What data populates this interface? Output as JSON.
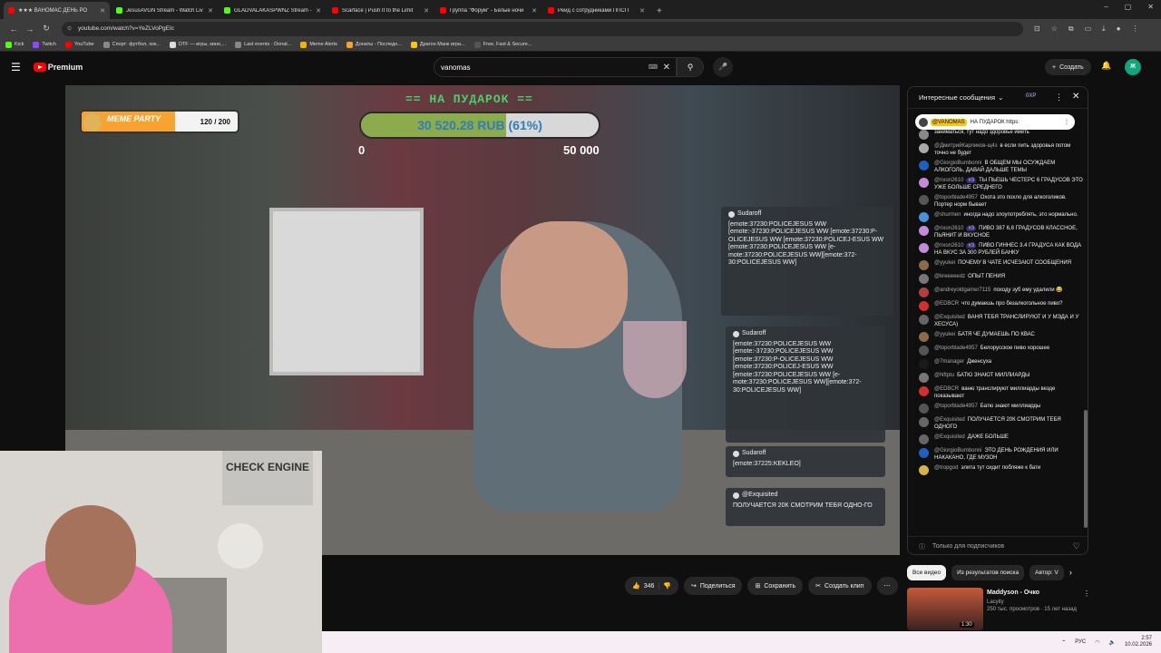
{
  "browser": {
    "tabs": [
      {
        "title": "★★★ ВАНОМАС ДЕНЬ РО",
        "color": "#ff0000",
        "active": true
      },
      {
        "title": "JesusAVGN Stream - Watch Liv",
        "color": "#53fc18",
        "active": false
      },
      {
        "title": "GLADVALAKASPWNZ Stream -",
        "color": "#53fc18",
        "active": false
      },
      {
        "title": "Scarface | Push It to the Limit",
        "color": "#ff0000",
        "active": false
      },
      {
        "title": "Группа \"Форум\" - Белые ночи",
        "color": "#ff0000",
        "active": false
      },
      {
        "title": "Рейд с сотрудниками ППСП",
        "color": "#ff0000",
        "active": false
      }
    ],
    "new_tab": "+",
    "window_controls": [
      "‒",
      "▢",
      "✕"
    ],
    "url": "youtube.com/watch?v=YeZLVoPgEIc",
    "bookmarks": [
      {
        "label": "Kick",
        "color": "#53fc18"
      },
      {
        "label": "Twitch",
        "color": "#9146ff"
      },
      {
        "label": "YouTube",
        "color": "#ff0000"
      },
      {
        "label": "Спорт: футбол, хок...",
        "color": "#888888"
      },
      {
        "label": "DTF — игры, кино,...",
        "color": "#dddddd"
      },
      {
        "label": "Last events - Donat...",
        "color": "#888888"
      },
      {
        "label": "Meme Alerts",
        "color": "#f5b400"
      },
      {
        "label": "Донаты - Последн...",
        "color": "#f7a231"
      },
      {
        "label": "Драгон Манк игра...",
        "color": "#f5c518"
      },
      {
        "label": "Free, Fast & Secure...",
        "color": "#555555"
      }
    ]
  },
  "youtube": {
    "logo_label": "Premium",
    "search_value": "vanomas",
    "create_label": "Создать",
    "avatar_letter": "Ж"
  },
  "overlay": {
    "donation_title": "== НА ПУДАРОК ==",
    "donation_value": "30 520.28 RUB (61%)",
    "donation_progress": 0.61,
    "donation_min": "0",
    "donation_max": "50 000",
    "meme_label": "MEME PARTY",
    "meme_value": "120 / 200",
    "meme_progress": 0.6,
    "popups": [
      {
        "user": "Sudaroff",
        "text": "[emote:37230:POLICEJESUS WW [emote:-37230:POLICEJESUS WW [emote:37230:P-OLICEJESUS WW [emote:37230:POLICEJ-ESUS WW [emote:37230:POLICEJESUS WW [e-mote:37230:POLICEJESUS WW][emote:372-30:POLICEJESUS WW]"
      },
      {
        "user": "Sudaroff",
        "text": "[emote:37230:POLICEJESUS WW [emote:-37230:POLICEJESUS WW [emote:37230:P-OLICEJESUS WW [emote:37230:POLICEJ-ESUS WW [emote:37230:POLICEJESUS WW [e-mote:37230:POLICEJESUS WW][emote:372-30:POLICEJESUS WW]"
      },
      {
        "user": "Sudaroff",
        "text": "[emote:37225:KEKLEO]"
      },
      {
        "user": "@Exquisited",
        "text": "ПОЛУЧАЕТСЯ 20К СМОТРИМ ТЕБЯ ОДНО-ГО"
      }
    ],
    "cam_sign": "CHECK ENGINE"
  },
  "actions": {
    "likes": "346",
    "share": "Поделиться",
    "save": "Сохранить",
    "clip": "Создать клип"
  },
  "chat": {
    "mode": "Интересные сообщения",
    "xp": "0XP",
    "pinned_user": "@VANOMAS",
    "pinned_text": "НА ПУДАРОК https:",
    "messages": [
      {
        "user": "",
        "badge": "",
        "text": "заниматься, тут надо здоровье иметь",
        "color": "#888888"
      },
      {
        "user": "@ДмитрийКарликов-щ4з",
        "badge": "",
        "text": "в если пить здоровья потом точно не будет",
        "color": "#aaaaaa"
      },
      {
        "user": "@GiorgioBumbonni",
        "badge": "",
        "text": "В ОБЩЕМ МЫ ОСУЖДАЕМ АЛКОГОЛЬ, ДАВАЙ ДАЛЬШЕ ТЕМЫ",
        "color": "#1f5fbf"
      },
      {
        "user": "@rixon2610",
        "badge": "#3",
        "text": "ТЫ ПЬЕШЬ ЧЕСТЕРС 6 ГРАДУСОВ ЭТО УЖЕ БОЛЬШЕ СРЕДНЕГО",
        "color": "#c48bd8"
      },
      {
        "user": "@toporblade4957",
        "badge": "",
        "text": "Охота это похло для алкоголиков. Портер норм бывает",
        "color": "#555555"
      },
      {
        "user": "@shurmen",
        "badge": "",
        "text": "иногда надо злоупотреблять, это нормально.",
        "color": "#4a90d9"
      },
      {
        "user": "@rixon2610",
        "badge": "#3",
        "text": "ПИВО 387 6,8 ГРАДУСОВ КЛАССНОЕ, ПЬЯНИТ И ВКУСНОЕ",
        "color": "#c48bd8"
      },
      {
        "user": "@rixon2610",
        "badge": "#3",
        "text": "ПИВО ГИННЕС 3.4 ГРАДУСА КАК ВОДА НА ВКУС ЗА 300 РУБЛЕЙ БАНКУ",
        "color": "#c48bd8"
      },
      {
        "user": "@yyukei",
        "badge": "",
        "text": "ПОЧЕМУ В ЧАТЕ ИСЧЕЗАЮТ СООБЩЕНИЯ",
        "color": "#8a6a4a"
      },
      {
        "user": "@kreeeeedz",
        "badge": "",
        "text": "ОПЫТ ПЕНИЯ",
        "color": "#777777"
      },
      {
        "user": "@andreyoldgamer7115",
        "badge": "",
        "text": "походу зуб ему удалили 😂",
        "color": "#b04040"
      },
      {
        "user": "@EDBCR",
        "badge": "",
        "text": "что думаешь про безалкогольное пиво?",
        "color": "#d03030"
      },
      {
        "user": "@Exquisited",
        "badge": "",
        "text": "ВАНЯ ТЕБЯ ТРАНСЛИРУЮТ И У МЭДА И У ХЕСУСА)",
        "color": "#666666"
      },
      {
        "user": "@yyukei",
        "badge": "",
        "text": "БАТЯ ЧЕ ДУМАЕШЬ ПО КВАС",
        "color": "#8a6a4a"
      },
      {
        "user": "@toporblade4957",
        "badge": "",
        "text": "Белорусское пиво хорошее",
        "color": "#555555"
      },
      {
        "user": "@7manager",
        "badge": "",
        "text": "Дженсуха",
        "color": "#1a1a1a"
      },
      {
        "user": "@Nftptu",
        "badge": "",
        "text": "БАТЮ ЗНАЮТ МИЛЛИАРДЫ",
        "color": "#777777"
      },
      {
        "user": "@EDBCR",
        "badge": "",
        "text": "ваню транслируют миллиарды везде показывают",
        "color": "#d03030"
      },
      {
        "user": "@toporblade4957",
        "badge": "",
        "text": "Батю знают миллиарды",
        "color": "#555555"
      },
      {
        "user": "@Exquisited",
        "badge": "",
        "text": "ПОЛУЧАЕТСЯ 20К СМОТРИМ ТЕБЯ ОДНОГО",
        "color": "#666666"
      },
      {
        "user": "@Exquisited",
        "badge": "",
        "text": "ДАЖЕ БОЛЬШЕ",
        "color": "#666666"
      },
      {
        "user": "@GiorgioBumbonni",
        "badge": "",
        "text": "ЭТО ДЕНЬ РОЖДЕНИЯ ИЛИ НАКАКАНО, ГДЕ МУЗОН",
        "color": "#1f5fbf"
      },
      {
        "user": "@tropgod",
        "badge": "",
        "text": "элита тут сидит побляже к бати",
        "color": "#d4b44a"
      }
    ],
    "footer": "Только для подписчиков"
  },
  "related": {
    "chips": [
      "Все видео",
      "Из результатов поиска",
      "Автор: V"
    ],
    "title": "Maddyson - Очко",
    "channel": "Lacyity",
    "meta": "250 тыс. просмотров · 15 лет назад",
    "duration": "1:30"
  },
  "taskbar": {
    "lang": "РУС",
    "time": "2:57",
    "date": "10.02.2026"
  }
}
